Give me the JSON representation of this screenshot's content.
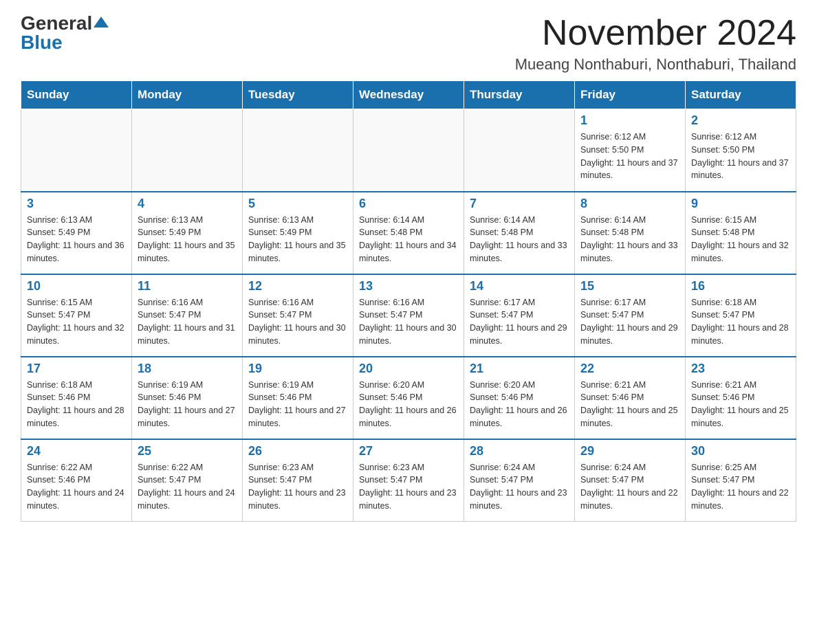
{
  "header": {
    "logo_general": "General",
    "logo_blue": "Blue",
    "month_title": "November 2024",
    "location": "Mueang Nonthaburi, Nonthaburi, Thailand"
  },
  "weekdays": [
    "Sunday",
    "Monday",
    "Tuesday",
    "Wednesday",
    "Thursday",
    "Friday",
    "Saturday"
  ],
  "weeks": [
    [
      {
        "day": "",
        "sunrise": "",
        "sunset": "",
        "daylight": ""
      },
      {
        "day": "",
        "sunrise": "",
        "sunset": "",
        "daylight": ""
      },
      {
        "day": "",
        "sunrise": "",
        "sunset": "",
        "daylight": ""
      },
      {
        "day": "",
        "sunrise": "",
        "sunset": "",
        "daylight": ""
      },
      {
        "day": "",
        "sunrise": "",
        "sunset": "",
        "daylight": ""
      },
      {
        "day": "1",
        "sunrise": "Sunrise: 6:12 AM",
        "sunset": "Sunset: 5:50 PM",
        "daylight": "Daylight: 11 hours and 37 minutes."
      },
      {
        "day": "2",
        "sunrise": "Sunrise: 6:12 AM",
        "sunset": "Sunset: 5:50 PM",
        "daylight": "Daylight: 11 hours and 37 minutes."
      }
    ],
    [
      {
        "day": "3",
        "sunrise": "Sunrise: 6:13 AM",
        "sunset": "Sunset: 5:49 PM",
        "daylight": "Daylight: 11 hours and 36 minutes."
      },
      {
        "day": "4",
        "sunrise": "Sunrise: 6:13 AM",
        "sunset": "Sunset: 5:49 PM",
        "daylight": "Daylight: 11 hours and 35 minutes."
      },
      {
        "day": "5",
        "sunrise": "Sunrise: 6:13 AM",
        "sunset": "Sunset: 5:49 PM",
        "daylight": "Daylight: 11 hours and 35 minutes."
      },
      {
        "day": "6",
        "sunrise": "Sunrise: 6:14 AM",
        "sunset": "Sunset: 5:48 PM",
        "daylight": "Daylight: 11 hours and 34 minutes."
      },
      {
        "day": "7",
        "sunrise": "Sunrise: 6:14 AM",
        "sunset": "Sunset: 5:48 PM",
        "daylight": "Daylight: 11 hours and 33 minutes."
      },
      {
        "day": "8",
        "sunrise": "Sunrise: 6:14 AM",
        "sunset": "Sunset: 5:48 PM",
        "daylight": "Daylight: 11 hours and 33 minutes."
      },
      {
        "day": "9",
        "sunrise": "Sunrise: 6:15 AM",
        "sunset": "Sunset: 5:48 PM",
        "daylight": "Daylight: 11 hours and 32 minutes."
      }
    ],
    [
      {
        "day": "10",
        "sunrise": "Sunrise: 6:15 AM",
        "sunset": "Sunset: 5:47 PM",
        "daylight": "Daylight: 11 hours and 32 minutes."
      },
      {
        "day": "11",
        "sunrise": "Sunrise: 6:16 AM",
        "sunset": "Sunset: 5:47 PM",
        "daylight": "Daylight: 11 hours and 31 minutes."
      },
      {
        "day": "12",
        "sunrise": "Sunrise: 6:16 AM",
        "sunset": "Sunset: 5:47 PM",
        "daylight": "Daylight: 11 hours and 30 minutes."
      },
      {
        "day": "13",
        "sunrise": "Sunrise: 6:16 AM",
        "sunset": "Sunset: 5:47 PM",
        "daylight": "Daylight: 11 hours and 30 minutes."
      },
      {
        "day": "14",
        "sunrise": "Sunrise: 6:17 AM",
        "sunset": "Sunset: 5:47 PM",
        "daylight": "Daylight: 11 hours and 29 minutes."
      },
      {
        "day": "15",
        "sunrise": "Sunrise: 6:17 AM",
        "sunset": "Sunset: 5:47 PM",
        "daylight": "Daylight: 11 hours and 29 minutes."
      },
      {
        "day": "16",
        "sunrise": "Sunrise: 6:18 AM",
        "sunset": "Sunset: 5:47 PM",
        "daylight": "Daylight: 11 hours and 28 minutes."
      }
    ],
    [
      {
        "day": "17",
        "sunrise": "Sunrise: 6:18 AM",
        "sunset": "Sunset: 5:46 PM",
        "daylight": "Daylight: 11 hours and 28 minutes."
      },
      {
        "day": "18",
        "sunrise": "Sunrise: 6:19 AM",
        "sunset": "Sunset: 5:46 PM",
        "daylight": "Daylight: 11 hours and 27 minutes."
      },
      {
        "day": "19",
        "sunrise": "Sunrise: 6:19 AM",
        "sunset": "Sunset: 5:46 PM",
        "daylight": "Daylight: 11 hours and 27 minutes."
      },
      {
        "day": "20",
        "sunrise": "Sunrise: 6:20 AM",
        "sunset": "Sunset: 5:46 PM",
        "daylight": "Daylight: 11 hours and 26 minutes."
      },
      {
        "day": "21",
        "sunrise": "Sunrise: 6:20 AM",
        "sunset": "Sunset: 5:46 PM",
        "daylight": "Daylight: 11 hours and 26 minutes."
      },
      {
        "day": "22",
        "sunrise": "Sunrise: 6:21 AM",
        "sunset": "Sunset: 5:46 PM",
        "daylight": "Daylight: 11 hours and 25 minutes."
      },
      {
        "day": "23",
        "sunrise": "Sunrise: 6:21 AM",
        "sunset": "Sunset: 5:46 PM",
        "daylight": "Daylight: 11 hours and 25 minutes."
      }
    ],
    [
      {
        "day": "24",
        "sunrise": "Sunrise: 6:22 AM",
        "sunset": "Sunset: 5:46 PM",
        "daylight": "Daylight: 11 hours and 24 minutes."
      },
      {
        "day": "25",
        "sunrise": "Sunrise: 6:22 AM",
        "sunset": "Sunset: 5:47 PM",
        "daylight": "Daylight: 11 hours and 24 minutes."
      },
      {
        "day": "26",
        "sunrise": "Sunrise: 6:23 AM",
        "sunset": "Sunset: 5:47 PM",
        "daylight": "Daylight: 11 hours and 23 minutes."
      },
      {
        "day": "27",
        "sunrise": "Sunrise: 6:23 AM",
        "sunset": "Sunset: 5:47 PM",
        "daylight": "Daylight: 11 hours and 23 minutes."
      },
      {
        "day": "28",
        "sunrise": "Sunrise: 6:24 AM",
        "sunset": "Sunset: 5:47 PM",
        "daylight": "Daylight: 11 hours and 23 minutes."
      },
      {
        "day": "29",
        "sunrise": "Sunrise: 6:24 AM",
        "sunset": "Sunset: 5:47 PM",
        "daylight": "Daylight: 11 hours and 22 minutes."
      },
      {
        "day": "30",
        "sunrise": "Sunrise: 6:25 AM",
        "sunset": "Sunset: 5:47 PM",
        "daylight": "Daylight: 11 hours and 22 minutes."
      }
    ]
  ]
}
